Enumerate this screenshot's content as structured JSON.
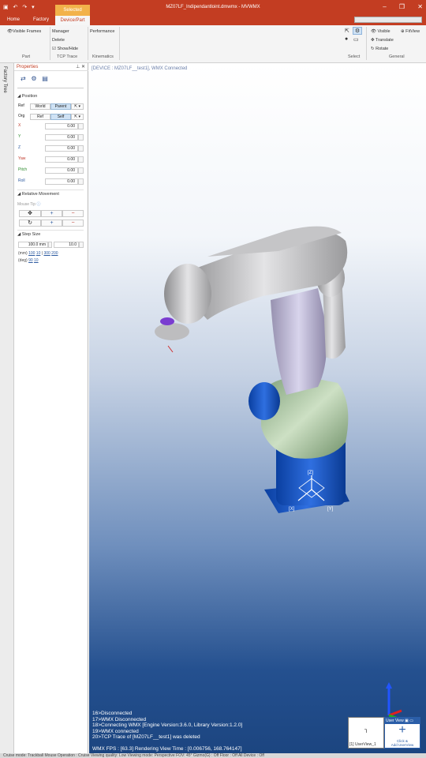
{
  "window": {
    "title": "MZ07LF_Indipendantloint.dmwmx - MVWMX"
  },
  "tabs": {
    "home": "Home",
    "factory": "Factory",
    "context_header": "Selected",
    "context_tab": "Device/Part"
  },
  "ribbon": {
    "visible_frames": "Visible Frames",
    "manager": "Manager",
    "delete": "Delete",
    "show_hide": "Show/Hide",
    "performance": "Performance",
    "visible": "Visible",
    "fit_view": "FitView",
    "translate": "Translate",
    "rotate": "Rotate",
    "groups": {
      "part": "Part",
      "tcp_trace": "TCP Trace",
      "kinematics": "Kinematics",
      "select": "Select",
      "general": "General"
    }
  },
  "side_tab": {
    "label": "Factory Tree"
  },
  "properties": {
    "title": "Properties",
    "position": {
      "header": "Position",
      "ref_label": "Ref",
      "ref_world": "World",
      "ref_parent": "Parent",
      "org_label": "Org",
      "org_ref": "Ref",
      "org_self": "Self",
      "fields": [
        {
          "label": "X",
          "value": "0.00",
          "color": "#c0392b"
        },
        {
          "label": "Y",
          "value": "0.00",
          "color": "#2e8b2e"
        },
        {
          "label": "Z",
          "value": "0.00",
          "color": "#2c5aa0"
        },
        {
          "label": "Yaw",
          "value": "0.00",
          "color": "#c0392b"
        },
        {
          "label": "Pitch",
          "value": "0.00",
          "color": "#2e8b2e"
        },
        {
          "label": "Roll",
          "value": "0.00",
          "color": "#2c5aa0"
        }
      ]
    },
    "relative": {
      "header": "Relative Movement",
      "mouse_tip": "Mouse Tip"
    },
    "step": {
      "header": "Step Size",
      "mm_value": "100.0",
      "mm_unit": "mm",
      "deg_value": "10.0",
      "mm_prefix": "(mm)",
      "mm_links": [
        "100",
        "10",
        "300",
        "200"
      ],
      "deg_prefix": "(deg)",
      "deg_links": [
        "90",
        "10"
      ]
    }
  },
  "viewport": {
    "device_label": "[DEVICE : MZ07LF__test1], WMX Connected",
    "axis_z": "[Z]",
    "axis_x": "[X]",
    "axis_y": "[Y]",
    "log": [
      "16>Disconnected",
      "17>WMX Disconnected",
      "18>Connecting WMX [Engine Version:3.6.0, Library Version:1.2.0]",
      "19>WMX connected",
      "20>TCP Trace of [MZ07LF__test1] was deleted"
    ],
    "fps": "WMX FPS : [63.3] Rendering View Time : [0.006756, 168.764147]"
  },
  "userviews": {
    "view1_label": "[1] UserView_1",
    "panel_header": "User View",
    "add_label_1": "Click &",
    "add_label_2": "Add UserView"
  },
  "statusbar": {
    "text": "Cruise mode: Trackball    Mouse Operation : Cruise    Viewing quality: Low    Viewing mode: Perspective    FOV: 45°    Gizmo(G) : Off    Floor : Off    All Device : Off"
  }
}
